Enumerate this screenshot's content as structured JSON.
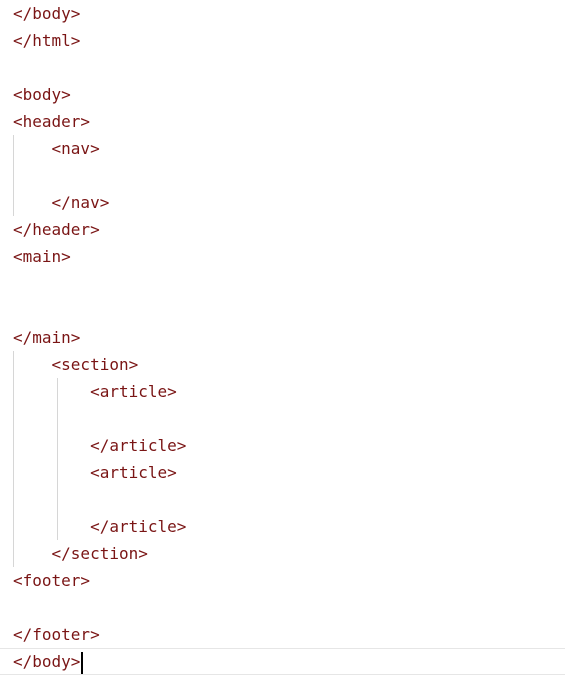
{
  "editor": {
    "lines": [
      "</body>",
      "</html>",
      "",
      "<body>",
      "<header>",
      "    <nav>",
      "",
      "    </nav>",
      "</header>",
      "<main>",
      "",
      "",
      "</main>",
      "    <section>",
      "        <article>",
      "",
      "        </article>",
      "        <article>",
      "",
      "        </article>",
      "    </section>",
      "<footer>",
      "",
      "</footer>",
      "</body>"
    ],
    "text_color": "#7a1515",
    "cursor_line": 25
  }
}
